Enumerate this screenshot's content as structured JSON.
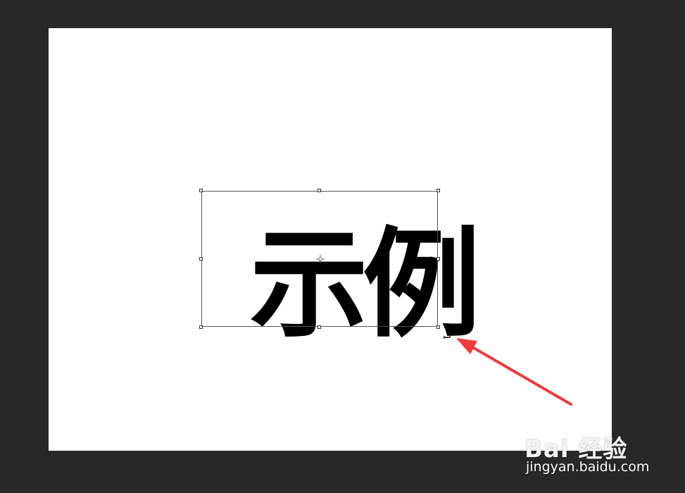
{
  "canvas": {
    "background": "#ffffff",
    "text_layer": {
      "content": "示例",
      "color": "#000000"
    }
  },
  "transform": {
    "handles": [
      "top-left",
      "top-center",
      "top-right",
      "middle-left",
      "middle-right",
      "bottom-left",
      "bottom-center",
      "bottom-right"
    ],
    "rotate_cursor_icon": "rotate-cursor-icon",
    "center_point_icon": "crosshair-icon"
  },
  "annotation": {
    "arrow_color": "#ee3b3b",
    "arrow_icon": "arrow-icon"
  },
  "watermark": {
    "logo_text": "Bai  经验",
    "url": "jingyan.baidu.com"
  },
  "workspace": {
    "background": "#282828"
  }
}
